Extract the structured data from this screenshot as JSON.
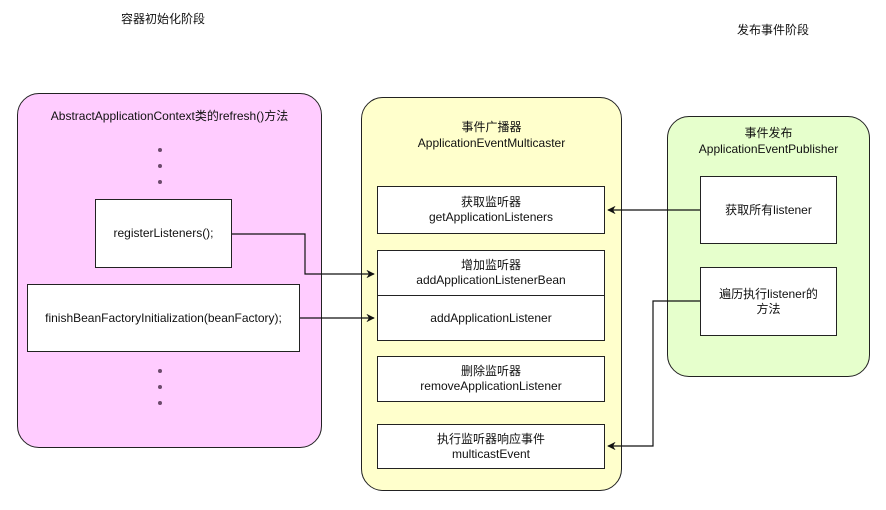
{
  "phases": {
    "init": "容器初始化阶段",
    "publish": "发布事件阶段"
  },
  "colors": {
    "init_container": "#FFCCFF",
    "multicaster_container": "#FFFFCC",
    "publisher_container": "#E6FFCC",
    "box": "#FFFFFF",
    "stroke": "#222222"
  },
  "init_container": {
    "title": "AbstractApplicationContext类的refresh()方法",
    "ellipsis": "⋮",
    "steps": [
      {
        "label": "registerListeners();"
      },
      {
        "label": "finishBeanFactoryInitialization(beanFactory);"
      }
    ]
  },
  "multicaster": {
    "title_cn": "事件广播器",
    "title_en": "ApplicationEventMulticaster",
    "methods": [
      {
        "cn": "获取监听器",
        "en": "getApplicationListeners"
      },
      {
        "cn": "增加监听器",
        "en": "addApplicationListenerBean"
      },
      {
        "cn": "",
        "en": "addApplicationListener"
      },
      {
        "cn": "删除监听器",
        "en": "removeApplicationListener"
      },
      {
        "cn": "执行监听器响应事件",
        "en": "multicastEvent"
      }
    ]
  },
  "publisher": {
    "title_cn": "事件发布",
    "title_en": "ApplicationEventPublisher",
    "steps": [
      {
        "label": "获取所有listener"
      },
      {
        "label_line1": "遍历执行listener的",
        "label_line2": "方法"
      }
    ]
  },
  "connections": [
    {
      "from": "registerListeners();",
      "to": "addApplicationListenerBean"
    },
    {
      "from": "finishBeanFactoryInitialization(beanFactory);",
      "to": "addApplicationListener"
    },
    {
      "from": "获取所有listener",
      "to": "getApplicationListeners"
    },
    {
      "from": "遍历执行listener的方法",
      "to": "multicastEvent"
    }
  ]
}
